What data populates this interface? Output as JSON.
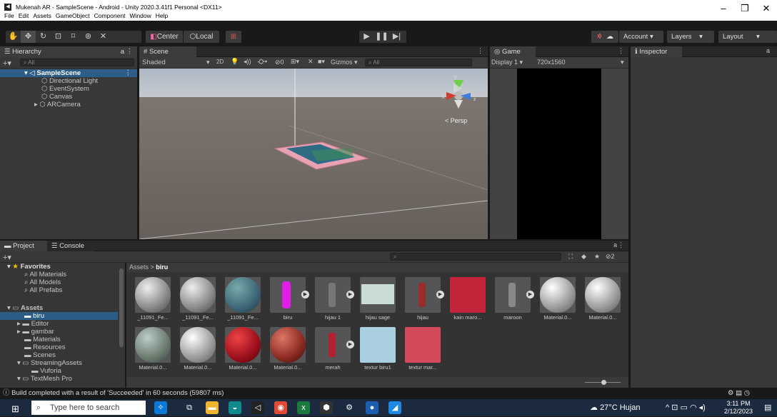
{
  "window": {
    "title": "Mukenah AR - SampleScene - Android - Unity 2020.3.41f1 Personal <DX11>",
    "app_icon": "unity-icon"
  },
  "menu": [
    "File",
    "Edit",
    "Assets",
    "GameObject",
    "Component",
    "Window",
    "Help"
  ],
  "toolbar": {
    "center": "Center",
    "local": "Local",
    "account": "Account",
    "layers": "Layers",
    "layout": "Layout"
  },
  "hierarchy": {
    "tab": "Hierarchy",
    "search": "All",
    "scene": "SampleScene",
    "items": [
      "Directional Light",
      "EventSystem",
      "Canvas",
      "ARCamera"
    ]
  },
  "scene": {
    "tab": "Scene",
    "shading": "Shaded",
    "mode2d": "2D",
    "gizmos": "Gizmos",
    "search": "All",
    "persp": "< Persp",
    "layer_count": "0"
  },
  "game": {
    "tab": "Game",
    "display": "Display 1",
    "resolution": "720x1560"
  },
  "inspector": {
    "tab": "Inspector"
  },
  "project": {
    "tab_project": "Project",
    "tab_console": "Console",
    "hidden_count": "2",
    "favorites_label": "Favorites",
    "favorites": [
      "All Materials",
      "All Models",
      "All Prefabs"
    ],
    "assets_label": "Assets",
    "assets": [
      "biru",
      "Editor",
      "gambar",
      "Materials",
      "Resources",
      "Scenes",
      "StreamingAssets",
      "Vuforia",
      "TextMesh Pro"
    ],
    "breadcrumb_root": "Assets",
    "breadcrumb_leaf": "biru",
    "row1": [
      "_11091_Fe...",
      "_11091_Fe...",
      "_11091_Fe...",
      "biru",
      "hijau 1",
      "hijau sage",
      "hijau",
      "kain maro...",
      "maroon",
      "Material.0...",
      "Material.0..."
    ],
    "row2": [
      "Material.0...",
      "Material.0...",
      "Material.0...",
      "Material.0...",
      "merah",
      "textur biru1",
      "textur mar..."
    ]
  },
  "status": {
    "message": "Build completed with a result of 'Succeeded' in 60 seconds (59807 ms)"
  },
  "taskbar": {
    "search": "Type here to search",
    "weather": "27°C  Hujan",
    "time": "3:11 PM",
    "date": "2/12/2023"
  },
  "colors": {
    "selection": "#2c5d87",
    "panel": "#383838",
    "taskbar": "#1b2a3e"
  }
}
